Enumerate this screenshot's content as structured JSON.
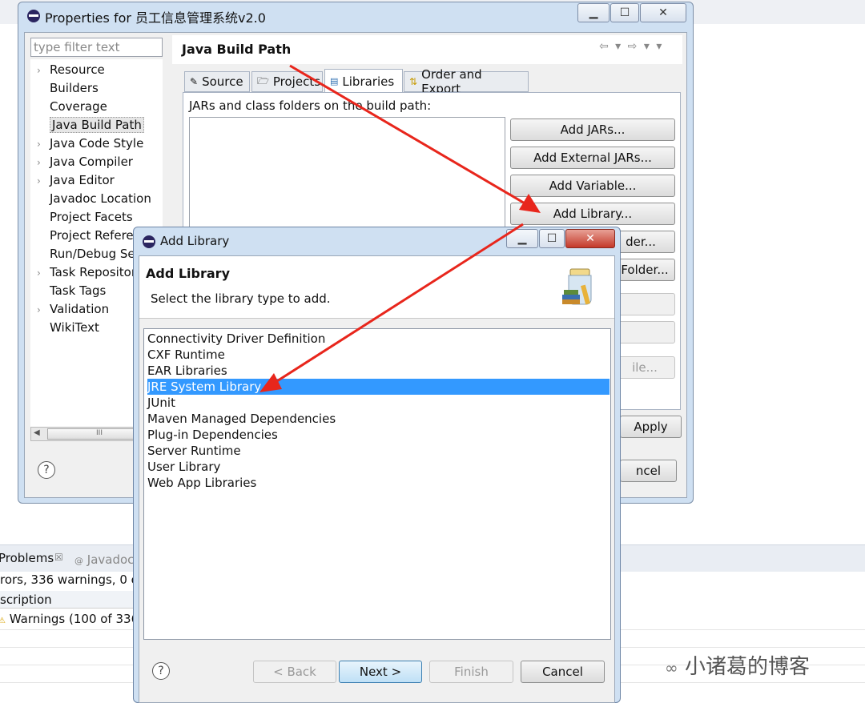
{
  "background": {
    "problems_tab": "Problems",
    "javadoc_tab": "Javadoc",
    "summary": "rors, 336 warnings, 0 ot",
    "description_header": "scription",
    "warnings_row": "Warnings (100 of 336"
  },
  "properties": {
    "title": "Properties for 员工信息管理系统v2.0",
    "filter_placeholder": "type filter text",
    "tree": [
      {
        "label": "Resource",
        "expandable": true
      },
      {
        "label": "Builders",
        "expandable": false
      },
      {
        "label": "Coverage",
        "expandable": false
      },
      {
        "label": "Java Build Path",
        "expandable": false,
        "selected": true
      },
      {
        "label": "Java Code Style",
        "expandable": true
      },
      {
        "label": "Java Compiler",
        "expandable": true
      },
      {
        "label": "Java Editor",
        "expandable": true
      },
      {
        "label": "Javadoc Location",
        "expandable": false
      },
      {
        "label": "Project Facets",
        "expandable": false
      },
      {
        "label": "Project Refere",
        "expandable": false
      },
      {
        "label": "Run/Debug Se",
        "expandable": false
      },
      {
        "label": "Task Repositor",
        "expandable": true
      },
      {
        "label": "Task Tags",
        "expandable": false
      },
      {
        "label": "Validation",
        "expandable": true
      },
      {
        "label": "WikiText",
        "expandable": false
      }
    ],
    "page_title": "Java Build Path",
    "tabs": [
      "Source",
      "Projects",
      "Libraries",
      "Order and Export"
    ],
    "active_tab": "Libraries",
    "jars_label": "JARs and class folders on the build path:",
    "side_buttons": [
      "Add JARs...",
      "Add External JARs...",
      "Add Variable...",
      "Add Library...",
      "der...",
      "Folder...",
      "ile..."
    ],
    "apply": "Apply",
    "cancel": "ncel",
    "help": "?"
  },
  "add_library": {
    "title": "Add Library",
    "header_title": "Add Library",
    "header_subtitle": "Select the library type to add.",
    "items": [
      "Connectivity Driver Definition",
      "CXF Runtime",
      "EAR Libraries",
      "JRE System Library",
      "JUnit",
      "Maven Managed Dependencies",
      "Plug-in Dependencies",
      "Server Runtime",
      "User Library",
      "Web App Libraries"
    ],
    "selected_item": "JRE System Library",
    "buttons": {
      "back": "< Back",
      "next": "Next >",
      "finish": "Finish",
      "cancel": "Cancel"
    },
    "help": "?"
  },
  "watermark": "小诸葛的博客",
  "colors": {
    "selection": "#3399ff",
    "arrow": "#e8261c",
    "dialog_frame": "#cfe0f2"
  }
}
